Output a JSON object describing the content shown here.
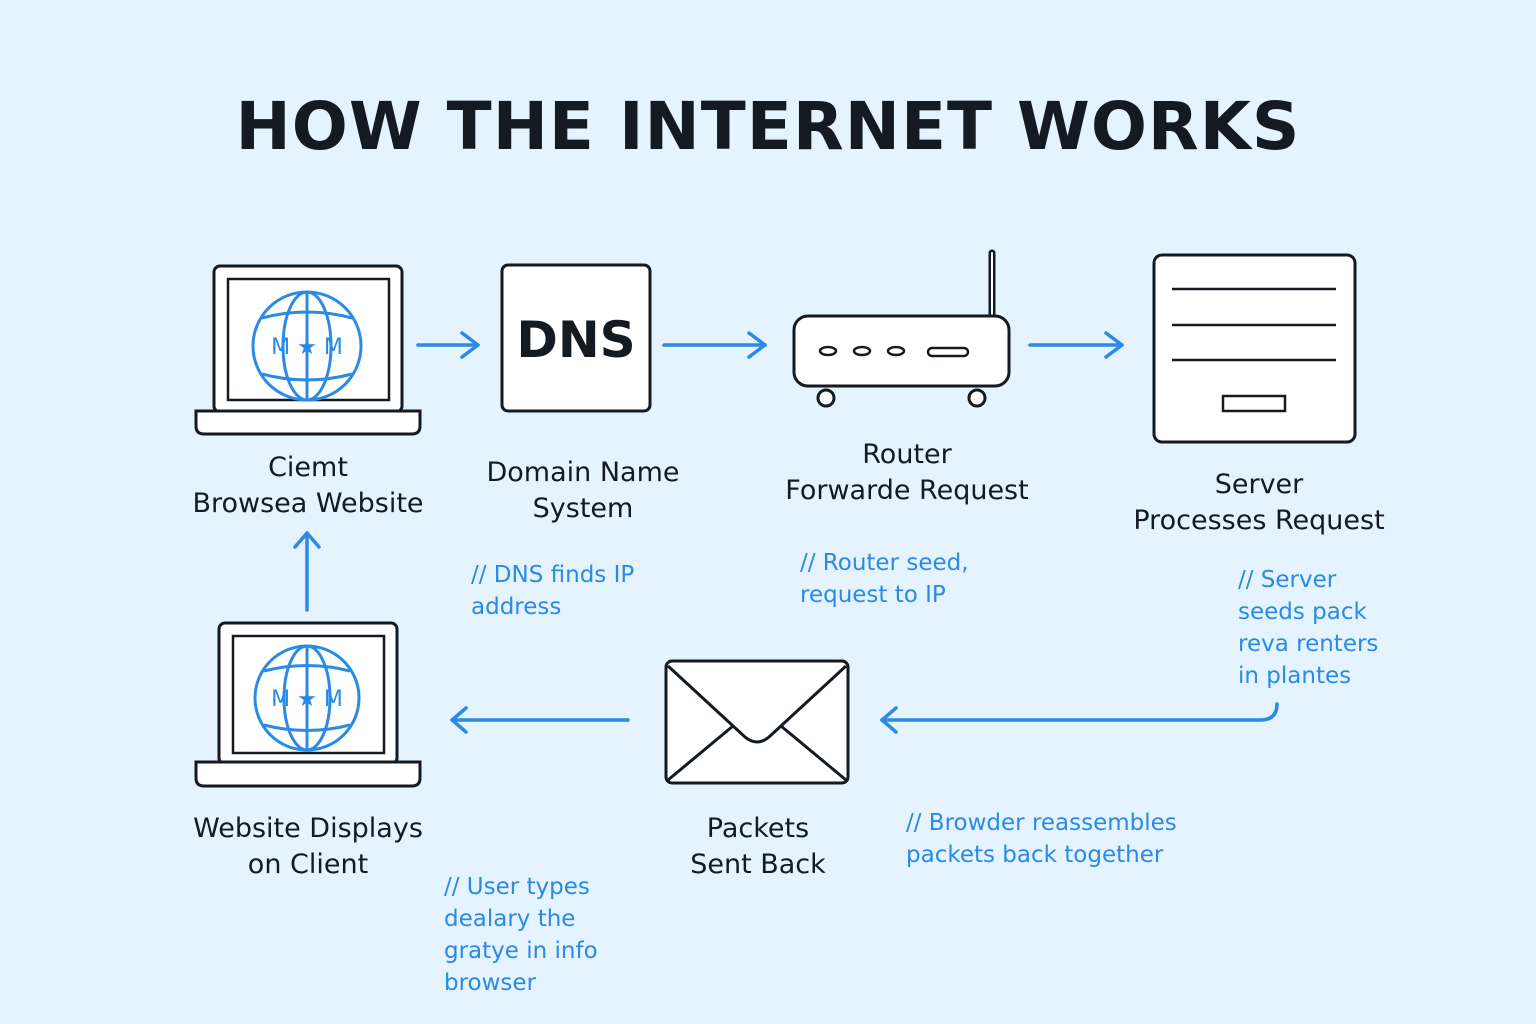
{
  "title": "HOW THE INTERNET WORKS",
  "colors": {
    "background": "#e4f3fd",
    "accent": "#2a8ae6",
    "ink": "#141a22"
  },
  "nodes": {
    "client": {
      "line1": "Ciemt",
      "line2": "Browsea Website",
      "icon": "laptop-globe-icon",
      "glyph": "M ★ M"
    },
    "dns": {
      "line1": "Domain Name",
      "line2": "System",
      "icon_text": "DNS"
    },
    "router": {
      "line1": "Router",
      "line2": "Forwarde Request",
      "icon": "router-icon"
    },
    "server": {
      "line1": "Server",
      "line2": "Processes Request",
      "icon": "server-document-icon"
    },
    "packets": {
      "line1": "Packets",
      "line2": "Sent Back",
      "icon": "envelope-icon"
    },
    "display": {
      "line1": "Website Displays",
      "line2": "on Client",
      "icon": "laptop-globe-icon",
      "glyph": "M ★ M"
    }
  },
  "notes": {
    "dns": [
      "// DNS finds IP",
      "address"
    ],
    "router": [
      "// Router seed,",
      "request to IP"
    ],
    "server": [
      "// Server",
      "seeds pack",
      "reva renters",
      "in plantes"
    ],
    "reassemble": [
      "// Browder reassembles",
      "packets back together"
    ],
    "user": [
      "// User types",
      "dealary the",
      "gratye in info",
      "browser"
    ]
  }
}
